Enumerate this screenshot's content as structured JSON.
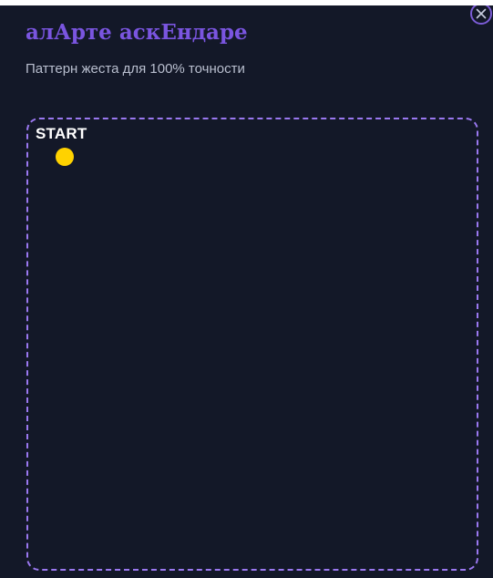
{
  "modal": {
    "title": "алАрте аскЕндаре",
    "subtitle": "Паттерн жеста для 100% точности",
    "close_icon": "close-icon"
  },
  "gesture_area": {
    "start_label": "START",
    "start_dot_color": "#ffd200",
    "border_color": "#9a78f0"
  },
  "colors": {
    "background": "#131828",
    "title": "#7a55e0",
    "accent": "#7b5cd6"
  }
}
